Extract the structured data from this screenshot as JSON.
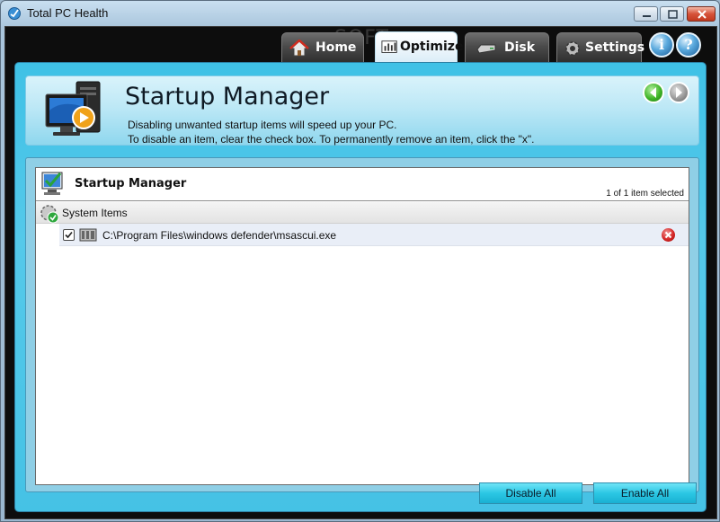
{
  "window": {
    "title": "Total PC Health"
  },
  "nav": {
    "tabs": [
      {
        "label": "Home",
        "icon": "home-icon"
      },
      {
        "label": "Optimize",
        "icon": "optimize-icon",
        "active": true
      },
      {
        "label": "Disk",
        "icon": "disk-icon"
      },
      {
        "label": "Settings",
        "icon": "settings-icon"
      }
    ],
    "info_label": "i",
    "help_label": "?"
  },
  "header": {
    "title": "Startup Manager",
    "description_line1": "Disabling unwanted startup items will speed up your PC.",
    "description_line2": "To disable an item, clear the check box.  To permanently remove an item, click the \"x\"."
  },
  "list": {
    "title": "Startup Manager",
    "selection_count": "1 of 1 item selected",
    "groups": [
      {
        "label": "System Items",
        "items": [
          {
            "path": "C:\\Program Files\\windows defender\\msascui.exe",
            "checked": true
          }
        ]
      }
    ]
  },
  "buttons": {
    "disable_all": "Disable All",
    "enable_all": "Enable All"
  },
  "colors": {
    "panel": "#45c2e5",
    "button": "#2bc7e4",
    "remove": "#d42525"
  }
}
